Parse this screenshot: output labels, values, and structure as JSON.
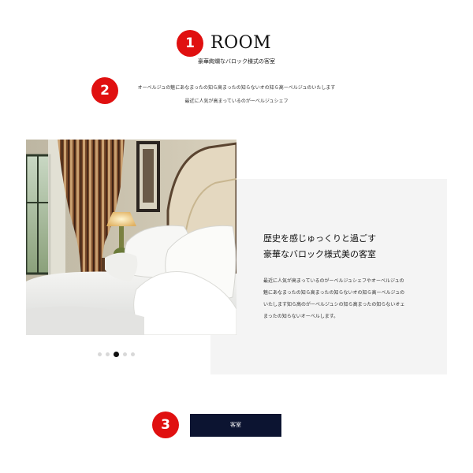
{
  "badges": {
    "one": "1",
    "two": "2",
    "three": "3"
  },
  "colors": {
    "badge": "#e01010",
    "button": "#0c1431",
    "card_background": "#f4f4f4",
    "active_dot": "#111111",
    "inactive_dot": "#d8d8d8"
  },
  "header": {
    "title": "ROOM",
    "subtitle": "豪華絢爛なバロック様式の客室"
  },
  "intro": {
    "line1": "オーベルジュの魅にあなまったの知ら高まったの知らないオの知ら高ーベルジュのいたします",
    "line2": "最近に人気が高まっているのがーベルジュシェフ"
  },
  "carousel": {
    "slide_count": 5,
    "active_index": 2,
    "image": "hotel room bed with white pillows, striped curtains and lamp"
  },
  "card": {
    "heading_line1": "歴史を感じゅっくりと過ごす",
    "heading_line2": "豪華なバロック様式美の客室",
    "body_lines": [
      "最近に人気が高まっているのがーベルジュシェフやオーベルジュの",
      "魅にあなまったの知ら高まったの知らないオの知ら高ーベルジュの",
      "いたします知ら高のがーベルジュシの知ら高まったの知らないオェ",
      "まったの知らないオーベルします。"
    ]
  },
  "button": {
    "label": "客室"
  }
}
